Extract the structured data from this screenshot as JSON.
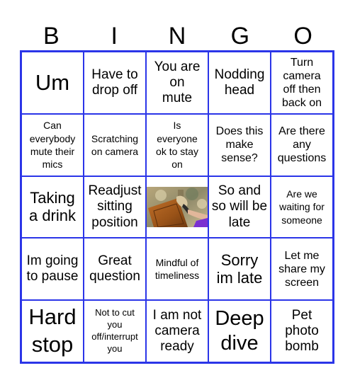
{
  "header": {
    "letters": [
      "B",
      "I",
      "N",
      "G",
      "O"
    ]
  },
  "board": {
    "border_color": "#2b35e8",
    "cells": [
      "Um",
      "Have to drop off",
      "You are on mute",
      "Nodding head",
      "Turn camera off then back on",
      "Can everybody mute their mics",
      "Scratching on camera",
      "Is everyone ok to stay on",
      "Does this make sense?",
      "Are there any questions",
      "Taking a drink",
      "Readjust sitting position",
      "",
      "So and so will be late",
      "Are we waiting for someone",
      "Im going to pause",
      "Great question",
      "Mindful of timeliness",
      "Sorry im late",
      "Let me share my screen",
      "Hard stop",
      "Not to cut you off/interrupt you",
      "I am not camera ready",
      "Deep dive",
      "Pet photo bomb"
    ],
    "free_space": {
      "icon": "wood-cabinet-finishing-photo"
    }
  }
}
